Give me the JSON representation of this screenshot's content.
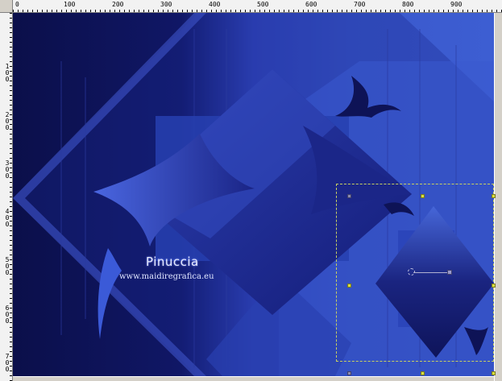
{
  "ruler": {
    "horizontal_labels": [
      "0",
      "100",
      "200",
      "300",
      "400",
      "500",
      "600",
      "700",
      "800",
      "900"
    ],
    "vertical_labels": [
      "1\n0\n0",
      "2\n0\n0",
      "3\n0\n0",
      "4\n0\n0",
      "5\n0\n0",
      "6\n0\n0",
      "7\n0\n0"
    ]
  },
  "watermark": {
    "title": "Pinuccia",
    "url": "www.maidiregrafica.eu"
  },
  "colors": {
    "canvas_dark": "#0d1150",
    "canvas_mid": "#2a3ca8",
    "canvas_light": "#3d5ed0",
    "selection_border": "#c8d060",
    "handle_yellow": "#d8e040"
  },
  "tools": {
    "active": "pick-tool",
    "icons": [
      "rotation-pivot-icon",
      "rotation-handle-icon"
    ]
  }
}
